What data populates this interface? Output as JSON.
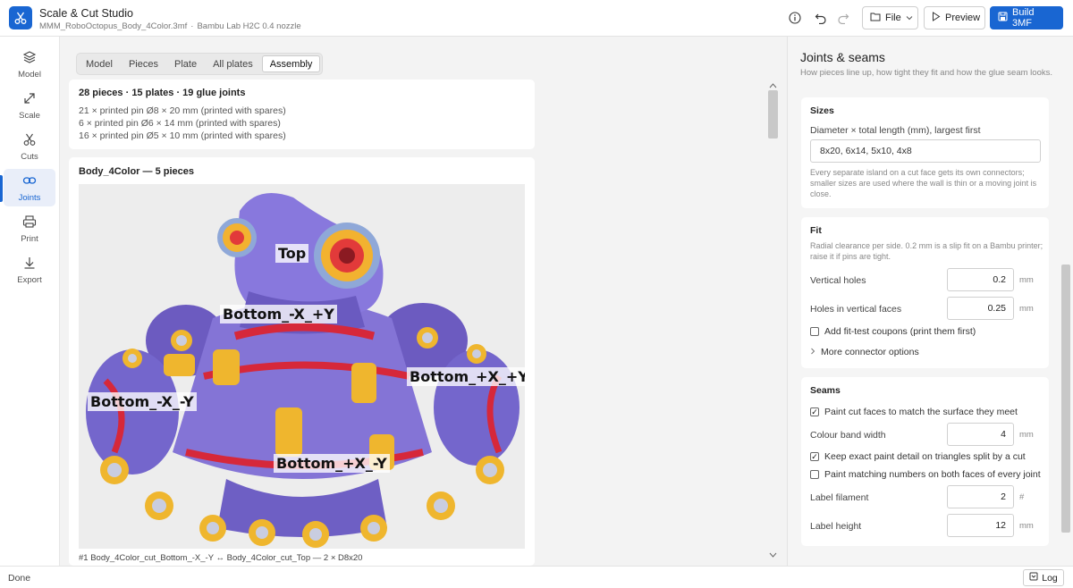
{
  "header": {
    "app_title": "Scale & Cut Studio",
    "file_name": "MMM_RoboOctopus_Body_4Color.3mf",
    "printer": "Bambu Lab H2C 0.4 nozzle",
    "file_label": "File",
    "preview_label": "Preview",
    "build_label": "Build 3MF"
  },
  "nav": {
    "items": [
      {
        "label": "Model",
        "icon": "layers-icon"
      },
      {
        "label": "Scale",
        "icon": "scale-arrow-icon"
      },
      {
        "label": "Cuts",
        "icon": "scissors-icon"
      },
      {
        "label": "Joints",
        "icon": "link-icon"
      },
      {
        "label": "Print",
        "icon": "printer-icon"
      },
      {
        "label": "Export",
        "icon": "download-icon"
      }
    ],
    "active": "Joints"
  },
  "main": {
    "tabs": [
      "Model",
      "Pieces",
      "Plate",
      "All plates",
      "Assembly"
    ],
    "active_tab": "Assembly",
    "summary": "28 pieces · 15 plates · 19 glue joints",
    "pin_lines": [
      "21 × printed pin Ø8 × 20 mm (printed with spares)",
      "6 × printed pin Ø6 × 14 mm (printed with spares)",
      "16 × printed pin Ø5 × 10 mm (printed with spares)"
    ],
    "part_title": "Body_4Color — 5 pieces",
    "piece_labels": [
      "Top",
      "Bottom_-X_+Y",
      "Bottom_+X_+Y",
      "Bottom_-X_-Y",
      "Bottom_+X_-Y"
    ],
    "joint_line": "#1  Body_4Color_cut_Bottom_-X_-Y  ↔  Body_4Color_cut_Top  —  2 × D8x20"
  },
  "panel": {
    "title": "Joints & seams",
    "subtitle": "How pieces line up, how tight they fit and how the glue seam looks.",
    "sizes": {
      "heading": "Sizes",
      "label": "Diameter × total length (mm), largest first",
      "value": "8x20, 6x14, 5x10, 4x8",
      "help": "Every separate island on a cut face gets its own connectors; smaller sizes are used where the wall is thin or a moving joint is close."
    },
    "fit": {
      "heading": "Fit",
      "help": "Radial clearance per side. 0.2 mm is a slip fit on a Bambu printer; raise it if pins are tight.",
      "vertical_holes_label": "Vertical holes",
      "vertical_holes_value": "0.2",
      "holes_faces_label": "Holes in vertical faces",
      "holes_faces_value": "0.25",
      "unit": "mm",
      "coupons_label": "Add fit-test coupons (print them first)",
      "coupons_checked": false,
      "more_label": "More connector options"
    },
    "seams": {
      "heading": "Seams",
      "paint_faces_label": "Paint cut faces to match the surface they meet",
      "paint_faces_checked": true,
      "band_label": "Colour band width",
      "band_value": "4",
      "unit": "mm",
      "keep_detail_label": "Keep exact paint detail on triangles split by a cut",
      "keep_detail_checked": true,
      "numbers_label": "Paint matching numbers on both faces of every joint",
      "numbers_checked": false,
      "filament_label": "Label filament",
      "filament_value": "2",
      "filament_unit": "#",
      "height_label": "Label height",
      "height_value": "12"
    }
  },
  "status": {
    "text": "Done",
    "log_label": "Log"
  }
}
